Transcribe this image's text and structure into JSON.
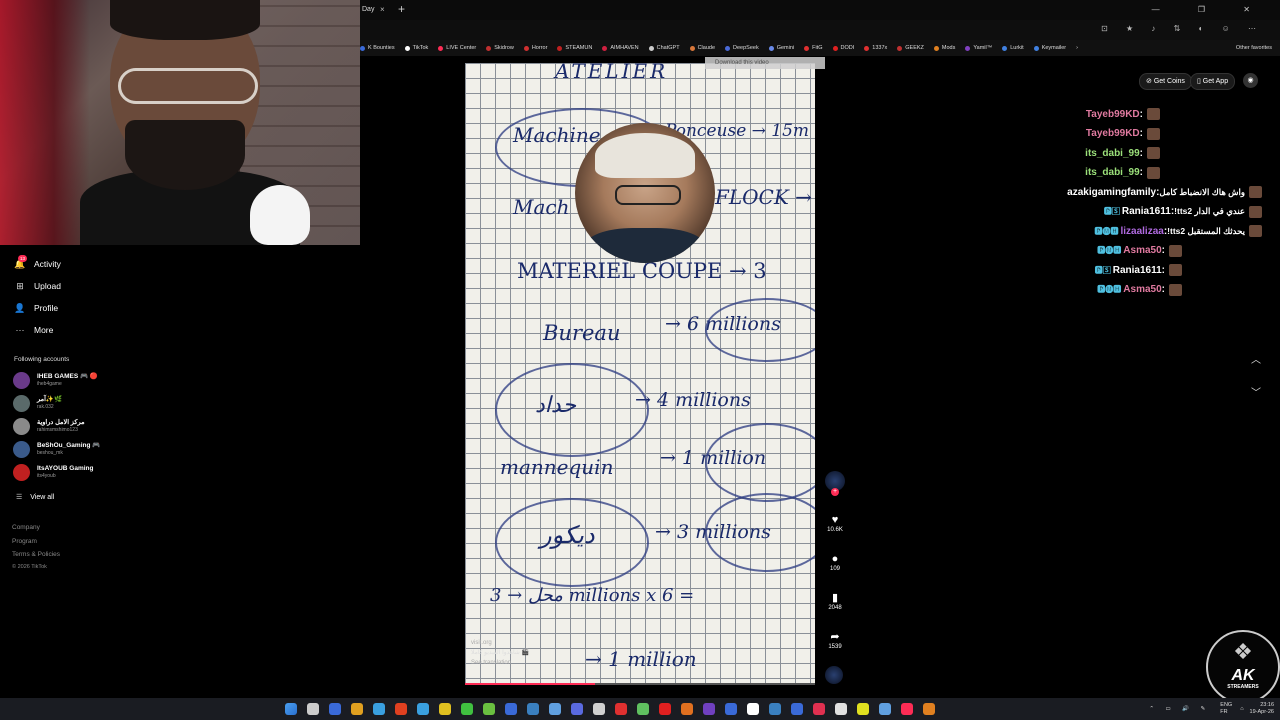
{
  "browser": {
    "tab_title": "Day",
    "tab_close": "×",
    "new_tab": "+",
    "window_controls": "— ❐ ✕",
    "toolbar_icons": "⊡ ★ ♪ ⇅ ◐ ☺ ⋯",
    "bookmarks": [
      {
        "label": "K Bounties",
        "color": "#3a6ad8"
      },
      {
        "label": "TikTok",
        "color": "#ffffff"
      },
      {
        "label": "LIVE Center",
        "color": "#fe2c55"
      },
      {
        "label": "Skidrow",
        "color": "#c03030"
      },
      {
        "label": "Horror",
        "color": "#d03030"
      },
      {
        "label": "STEAMUN",
        "color": "#c02020"
      },
      {
        "label": "AIMHAVEN",
        "color": "#d02040"
      },
      {
        "label": "ChatGPT",
        "color": "#cccccc"
      },
      {
        "label": "Claude",
        "color": "#d8773a"
      },
      {
        "label": "DeepSeek",
        "color": "#4a6ad8"
      },
      {
        "label": "Gemini",
        "color": "#6a8ae8"
      },
      {
        "label": "FitG",
        "color": "#e03030"
      },
      {
        "label": "DODI",
        "color": "#e02020"
      },
      {
        "label": "1337x",
        "color": "#e03030"
      },
      {
        "label": "GEEKZ",
        "color": "#c03030"
      },
      {
        "label": "Mods",
        "color": "#e08020"
      },
      {
        "label": "Yamil™",
        "color": "#8040c0"
      },
      {
        "label": "Lurkit",
        "color": "#4080e0"
      },
      {
        "label": "Keymailer",
        "color": "#4080e0"
      }
    ],
    "bookmarks_more": "›",
    "other_favorites": "Other favorites"
  },
  "sidebar": {
    "activity_badge": "13",
    "items": [
      {
        "label": "Activity",
        "icon": "bell-icon",
        "glyph": "🔔"
      },
      {
        "label": "Upload",
        "icon": "plus-icon",
        "glyph": "⊞"
      },
      {
        "label": "Profile",
        "icon": "user-icon",
        "glyph": "👤"
      },
      {
        "label": "More",
        "icon": "more-icon",
        "glyph": "···"
      }
    ],
    "following_heading": "Following accounts",
    "accounts": [
      {
        "name": "IHEB GAMES 🎮 🔴",
        "handle": "iheb4game",
        "color": "#6a3a8a"
      },
      {
        "name": "آمر✨🌿",
        "handle": "rak.032",
        "color": "#5a6a6a"
      },
      {
        "name": "مركز الامل دراوية",
        "handle": "rahimsmshimo123",
        "color": "#8a8a8a"
      },
      {
        "name": "BeShOu_Gaming 🎮",
        "handle": "beshou_mk",
        "color": "#3a5a8a"
      },
      {
        "name": "ItsAYOUB Gaming",
        "handle": "its4youb",
        "color": "#c02020"
      }
    ],
    "view_all": "View all",
    "footer": [
      "Company",
      "Program",
      "Terms & Policies",
      "© 2026 TikTok"
    ]
  },
  "video": {
    "download_label": "Download this video",
    "caption_user": "visit.org",
    "caption_text": "شاهدوا الفيديو كاملا 🎬",
    "see_translation": "See translation",
    "progress": 0.37,
    "handwriting": {
      "title": "ATELIER",
      "line1a": "Machine",
      "line1b": "Ponceuse → 15m",
      "line2a": "Mach",
      "line2b": "FLOCK →",
      "line3": "MATERIEL COUPE → 3",
      "line4a": "Bureau",
      "line4b": "→ 6 millions",
      "line5a": "حداد",
      "line5b": "→ 4 millions",
      "line6a": "mannequin",
      "line6b": "→ 1 million",
      "line7a": "ديكور",
      "line7b": "→ 3 millions",
      "line8": "محل → 3 millions x 6 =",
      "line9": "→ 1 million"
    }
  },
  "actions": {
    "like_count": "10.6K",
    "comment_count": "109",
    "save_count": "2048",
    "share_count": "1539",
    "follow_plus": "+",
    "like_glyph": "♥",
    "comment_glyph": "●",
    "save_glyph": "▮",
    "share_glyph": "➦"
  },
  "top_buttons": {
    "get_coins": "Get Coins",
    "get_app": "Get App",
    "profile_glyph": "◉"
  },
  "chat": [
    {
      "user": "Tayeb99KD",
      "sep": " :",
      "msg": "",
      "color": "#e07aa0",
      "badges": ""
    },
    {
      "user": "Tayeb99KD",
      "sep": " :",
      "msg": "",
      "color": "#e07aa0",
      "badges": ""
    },
    {
      "user": "its_dabi_99",
      "sep": " :",
      "msg": "",
      "color": "#9be07a",
      "badges": ""
    },
    {
      "user": "its_dabi_99",
      "sep": " :",
      "msg": "",
      "color": "#9be07a",
      "badges": ""
    },
    {
      "user": "azakigamingfamily",
      "sep": " :",
      "msg": " واش هاك الانضباط كامل",
      "color": "#ffffff",
      "badges": ""
    },
    {
      "user": "Rania1611",
      "sep": " :",
      "msg": " !tts2 عندي في الدار",
      "color": "#ffffff",
      "badges": "🅿🅂"
    },
    {
      "user": "lizaalizaa",
      "sep": " :",
      "msg": " !tts2 يحدثك المستقبل",
      "color": "#b06ae0",
      "badges": "🅿🅜🅷"
    },
    {
      "user": "Asma50",
      "sep": " :",
      "msg": "",
      "color": "#e07aa0",
      "badges": "🅿🅜🅷"
    },
    {
      "user": "Rania1611",
      "sep": " :",
      "msg": "",
      "color": "#ffffff",
      "badges": "🅿🅂"
    },
    {
      "user": "Asma50",
      "sep": " :",
      "msg": "",
      "color": "#e07aa0",
      "badges": "🅿🅜🅷"
    }
  ],
  "nav": {
    "up": "︿",
    "down": "﹀"
  },
  "logo": {
    "title": "AK",
    "subtitle": "STREAMERS"
  },
  "taskbar": {
    "apps": [
      "#3a8ae0",
      "#cccccc",
      "#3a6ad8",
      "#e0a020",
      "#3aa0e0",
      "#e04020",
      "#3aa0e0",
      "#e0c020",
      "#40c040",
      "#6ac040",
      "#3a6ad8",
      "#3a80c0",
      "#60a0e0",
      "#5a6ae0",
      "#d0d0d0",
      "#e03030",
      "#60c060",
      "#e02020",
      "#e07020",
      "#7040c0",
      "#3a6ad8",
      "#ffffff",
      "#3a80c0",
      "#3a6ad8",
      "#e03050",
      "#e0e0e0",
      "#e0e020",
      "#60a0e0",
      "#fe2c55",
      "#e08020"
    ],
    "lang": "ENG\nFR",
    "time": "23:16",
    "date": "19-Apr-26"
  }
}
